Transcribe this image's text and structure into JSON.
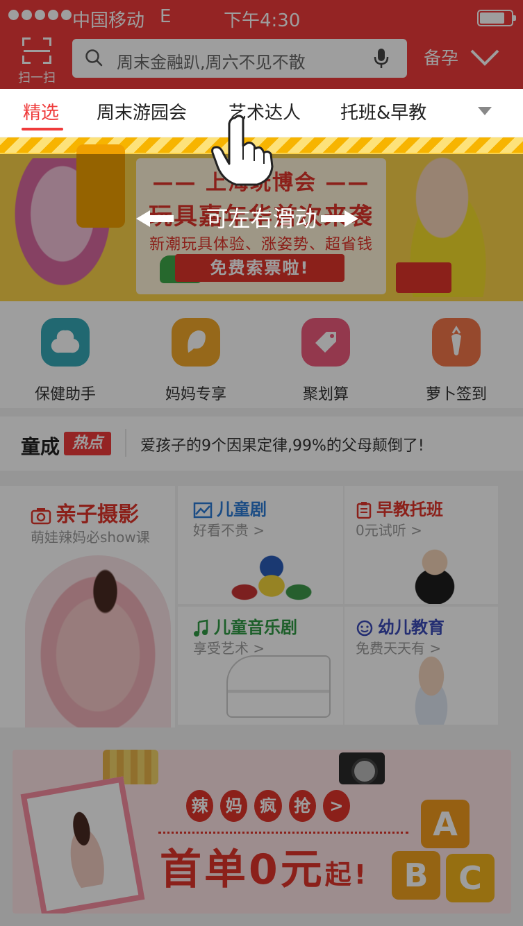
{
  "status_bar": {
    "carrier": "中国移动",
    "network": "E",
    "time": "下午4:30",
    "battery_level": 0.8
  },
  "header": {
    "scan_label": "扫一扫",
    "search_placeholder": "周末金融趴,周六不见不散",
    "stage_label": "备孕"
  },
  "tabs": [
    {
      "label": "精选",
      "active": true
    },
    {
      "label": "周末游园会"
    },
    {
      "label": "艺术达人"
    },
    {
      "label": "托班&早教"
    }
  ],
  "banner": {
    "line1": "—— 上海玩博会 ——",
    "line2": "玩具嘉年华首次来袭",
    "line3": "新潮玩具体验、涨姿势、超省钱",
    "button": "免费索票啦!"
  },
  "quick_icons": [
    {
      "label": "保健助手",
      "icon": "health-icon",
      "color": "#36a9b7"
    },
    {
      "label": "妈妈专享",
      "icon": "mom-icon",
      "color": "#f2a92a"
    },
    {
      "label": "聚划算",
      "icon": "tag-icon",
      "color": "#ee5b7c"
    },
    {
      "label": "萝卜签到",
      "icon": "carrot-icon",
      "color": "#f3764a"
    }
  ],
  "hot": {
    "brand": "童成",
    "badge": "热点",
    "headline": "爱孩子的9个因果定律,99%的父母颠倒了!"
  },
  "services": {
    "photo": {
      "title": "亲子摄影",
      "sub": "萌娃辣妈必show课"
    },
    "drama": {
      "title": "儿童剧",
      "sub": "好看不贵 >"
    },
    "early": {
      "title": "早教托班",
      "sub": "0元试听 >"
    },
    "music": {
      "title": "儿童音乐剧",
      "sub": "享受艺术 >"
    },
    "edu": {
      "title": "幼儿教育",
      "sub": "免费天天有 >"
    }
  },
  "promo": {
    "label_chars": [
      "辣",
      "妈",
      "疯",
      "抢",
      ">"
    ],
    "big_text": "首单0元",
    "big_suffix": "起!",
    "blocks": [
      "A",
      "B",
      "C"
    ]
  },
  "hint": {
    "text": "可左右滑动"
  },
  "colors": {
    "brand_red": "#ef3b3b",
    "accent_red": "#e1352b"
  }
}
